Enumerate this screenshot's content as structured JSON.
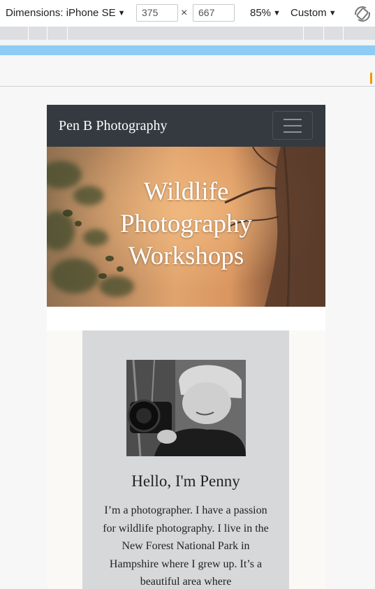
{
  "devtools": {
    "dimensions_label": "Dimensions: iPhone SE",
    "width_value": "375",
    "height_value": "667",
    "times": "×",
    "zoom_label": "85%",
    "throttle_label": "Custom"
  },
  "navbar": {
    "brand": "Pen B Photography"
  },
  "hero": {
    "title_line1": "Wildlife",
    "title_line2": "Photography",
    "title_line3": "Workshops"
  },
  "about": {
    "heading": "Hello, I'm Penny",
    "text": "I’m a photographer. I have a passion for wildlife photography. I live in the New Forest National Park in Hampshire where I grew up. It’s a beautiful area where"
  },
  "colors": {
    "navbar_bg": "#343a40",
    "card_bg": "#d7d8da",
    "media_bar": "#8ecbf5"
  }
}
